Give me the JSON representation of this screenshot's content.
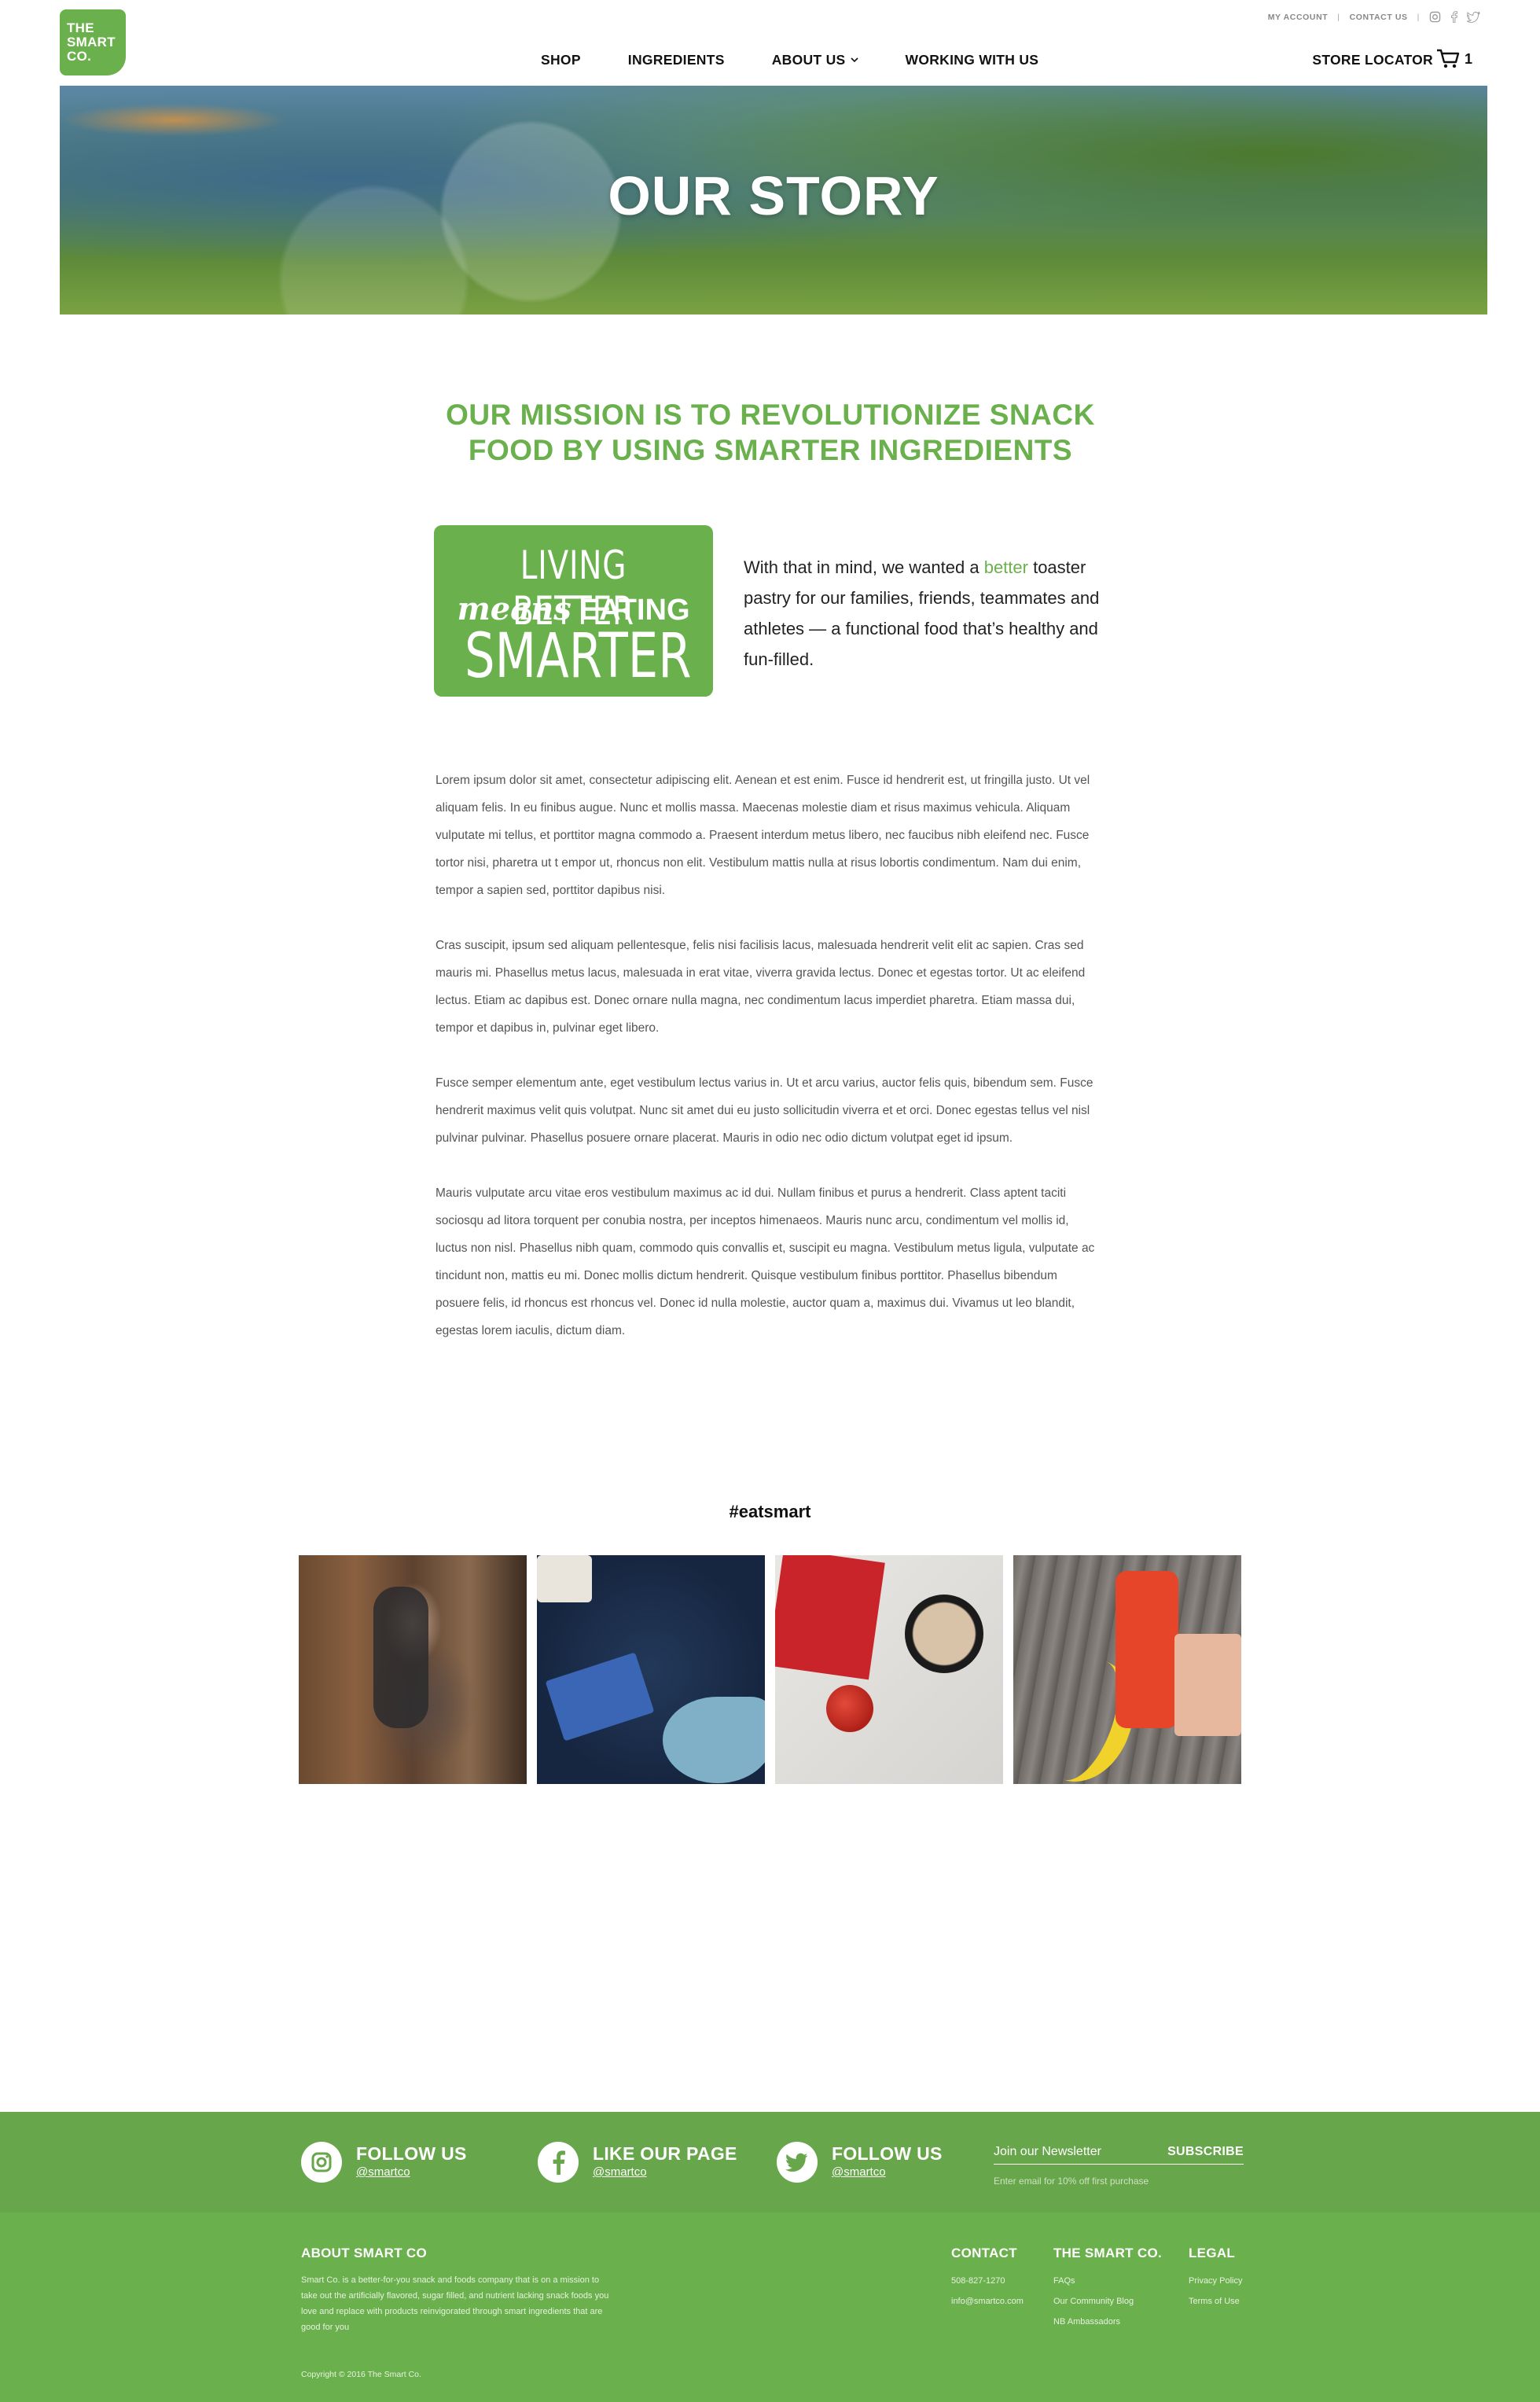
{
  "brand": {
    "logo_lines": [
      "THE",
      "SMART",
      "CO."
    ],
    "accent": "#6ab04c"
  },
  "utility_nav": {
    "my_account": "MY ACCOUNT",
    "separator": "|",
    "contact_us": "CONTACT US",
    "icons": [
      "instagram-icon",
      "facebook-icon",
      "twitter-icon"
    ]
  },
  "main_nav": {
    "items": [
      "SHOP",
      "INGREDIENTS",
      "ABOUT US",
      "WORKING WITH US"
    ],
    "store_locator": "STORE LOCATOR",
    "cart_count": "1"
  },
  "hero": {
    "title": "OUR STORY"
  },
  "mission": {
    "line1": "OUR MISSION IS TO REVOLUTIONIZE SNACK",
    "line2": "FOOD BY USING SMARTER INGREDIENTS"
  },
  "badge": {
    "line1": "LIVING BETTER",
    "line2a": "means",
    "line2b": "EATING",
    "line3": "SMARTER"
  },
  "intro": {
    "before": "With that in mind, we wanted a ",
    "highlight": "better",
    "after": " toaster pastry for our families, friends, teammates and athletes — a functional food that’s healthy and fun-filled."
  },
  "body_paragraphs": [
    "Lorem ipsum dolor sit amet, consectetur adipiscing elit. Aenean et est enim. Fusce id hendrerit est, ut fringilla justo. Ut vel aliquam felis. In eu finibus augue. Nunc et mollis massa. Maecenas molestie diam et risus maximus vehicula. Aliquam vulputate mi tellus, et porttitor magna commodo a. Praesent interdum metus libero, nec faucibus nibh eleifend nec. Fusce tortor nisi, pharetra ut t empor ut, rhoncus non elit. Vestibulum mattis nulla at risus lobortis condimentum. Nam dui enim, tempor a sapien sed, porttitor dapibus nisi.",
    "Cras suscipit, ipsum sed aliquam pellentesque, felis nisi facilisis lacus, malesuada hendrerit velit elit ac sapien. Cras sed mauris mi. Phasellus metus lacus, malesuada in erat vitae, viverra gravida lectus. Donec et egestas tortor. Ut ac eleifend lectus. Etiam ac dapibus est. Donec ornare nulla magna, nec condimentum lacus imperdiet pharetra. Etiam massa dui, tempor et dapibus in, pulvinar eget libero.",
    "Fusce semper elementum ante, eget vestibulum lectus varius in. Ut et arcu varius, auctor felis quis, bibendum sem. Fusce hendrerit maximus velit quis volutpat. Nunc sit amet dui eu justo sollicitudin viverra et et orci. Donec egestas tellus vel nisl pulvinar pulvinar. Phasellus posuere ornare placerat. Mauris in odio nec odio dictum volutpat eget id ipsum.",
    "Mauris vulputate arcu vitae eros vestibulum maximus ac id dui. Nullam finibus et purus a hendrerit. Class aptent taciti sociosqu ad litora torquent per conubia nostra, per inceptos himenaeos. Mauris nunc arcu, condimentum vel mollis id, luctus non nisl. Phasellus nibh quam, commodo quis convallis et, suscipit eu magna. Vestibulum metus ligula, vulputate ac tincidunt non, mattis eu mi. Donec mollis dictum hendrerit. Quisque vestibulum finibus porttitor. Phasellus bibendum posuere felis, id rhoncus est rhoncus vel. Donec id nulla molestie, auctor quam a, maximus dui. Vivamus ut leo blandit, egestas lorem iaculis, dictum diam."
  ],
  "instagram": {
    "hashtag": "#eatsmart"
  },
  "footer": {
    "social": [
      {
        "title": "FOLLOW US",
        "handle": "@smartco",
        "icon": "instagram-icon"
      },
      {
        "title": "LIKE OUR PAGE",
        "handle": "@smartco",
        "icon": "facebook-icon"
      },
      {
        "title": "FOLLOW US",
        "handle": "@smartco",
        "icon": "twitter-icon"
      }
    ],
    "newsletter": {
      "placeholder": "Join our Newsletter",
      "button": "SUBSCRIBE",
      "note": "Enter email for 10% off first purchase"
    },
    "about": {
      "title": "ABOUT SMART CO",
      "text": "Smart Co. is a better-for-you snack and foods company that is on a mission to take out the artificially flavored, sugar filled, and nutrient lacking snack foods you love and replace with products reinvigorated through smart ingredients that are good for you"
    },
    "contact": {
      "title": "CONTACT",
      "phone": "508-827-1270",
      "email": "info@smartco.com"
    },
    "company": {
      "title": "THE SMART CO.",
      "links": [
        "FAQs",
        "Our Community Blog",
        "NB Ambassadors"
      ]
    },
    "legal": {
      "title": "LEGAL",
      "links": [
        "Privacy Policy",
        "Terms of Use"
      ]
    },
    "copyright": "Copyright © 2016 The Smart Co."
  }
}
